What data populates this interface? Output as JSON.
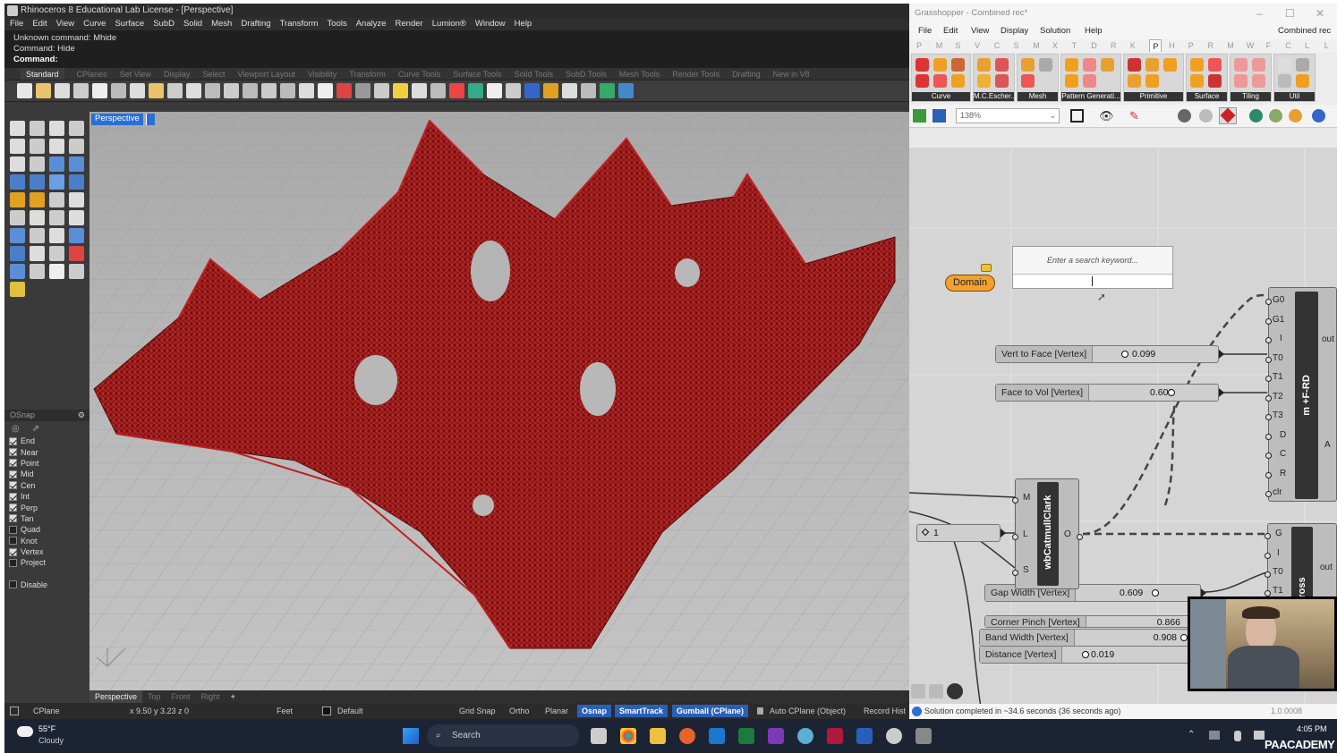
{
  "rhino": {
    "title": "Rhinoceros 8 Educational Lab License - [Perspective]",
    "menu": [
      "File",
      "Edit",
      "View",
      "Curve",
      "Surface",
      "SubD",
      "Solid",
      "Mesh",
      "Drafting",
      "Transform",
      "Tools",
      "Analyze",
      "Render",
      "Lumion®",
      "Window",
      "Help"
    ],
    "cmd_lines": [
      "Unknown command: Mhide",
      "Command: Hide"
    ],
    "cmd_prompt": "Command:",
    "toolbar_tabs": [
      "Standard",
      "CPlanes",
      "Set View",
      "Display",
      "Select",
      "Viewport Layout",
      "Visibility",
      "Transform",
      "Curve Tools",
      "Surface Tools",
      "Solid Tools",
      "SubD Tools",
      "Mesh Tools",
      "Render Tools",
      "Drafting",
      "New in V8"
    ],
    "viewport_label": "Perspective",
    "view_tabs": [
      "Perspective",
      "Top",
      "Front",
      "Right",
      "+"
    ],
    "osnap": {
      "title": "OSnap",
      "items": [
        {
          "label": "End",
          "checked": true
        },
        {
          "label": "Near",
          "checked": true
        },
        {
          "label": "Point",
          "checked": true
        },
        {
          "label": "Mid",
          "checked": true
        },
        {
          "label": "Cen",
          "checked": true
        },
        {
          "label": "Int",
          "checked": true
        },
        {
          "label": "Perp",
          "checked": true
        },
        {
          "label": "Tan",
          "checked": true
        },
        {
          "label": "Quad",
          "checked": false
        },
        {
          "label": "Knot",
          "checked": false
        },
        {
          "label": "Vertex",
          "checked": true
        },
        {
          "label": "Project",
          "checked": false
        }
      ],
      "disable": "Disable"
    },
    "status": {
      "cplane": "CPlane",
      "coords": "x 9.50 y 3.23 z 0",
      "units": "Feet",
      "layer": "Default",
      "grid_snap": "Grid Snap",
      "ortho": "Ortho",
      "planar": "Planar",
      "osnap": "Osnap",
      "smarttrack": "SmartTrack",
      "gumball": "Gumball (CPlane)",
      "auto_cplane": "Auto CPlane (Object)",
      "record": "Record Hist"
    },
    "colors": {
      "mesh": "#8e1515",
      "accent": "#2a6fd6"
    }
  },
  "gh": {
    "title": "Grasshopper - Combined rec*",
    "menu": [
      "File",
      "Edit",
      "View",
      "Display",
      "Solution",
      "Help"
    ],
    "doc_name": "Combined rec",
    "tab_letters": [
      "P",
      "M",
      "S",
      "V",
      "C",
      "S",
      "M",
      "X",
      "T",
      "D",
      "R",
      "K",
      "P",
      "H",
      "P",
      "R",
      "M",
      "W",
      "F",
      "C",
      "L",
      "L"
    ],
    "ribbon_groups": [
      "Curve",
      "M.C.Escher...",
      "Mesh",
      "Pattern Generati...",
      "Primitive",
      "Surface",
      "Tiling",
      "Util"
    ],
    "zoom": "138%",
    "search_placeholder": "Enter a search keyword...",
    "domain_label": "Domain",
    "sliders": {
      "vtf": {
        "label": "Vert to Face [Vertex]",
        "value": "0.099"
      },
      "ftv": {
        "label": "Face to Vol [Vertex]",
        "value": "0.602"
      },
      "gap": {
        "label": "Gap Width [Vertex]",
        "value": "0.609"
      },
      "corner": {
        "label": "Corner Pinch [Vertex]",
        "value": "0.866"
      },
      "band": {
        "label": "Band Width [Vertex]",
        "value": "0.908"
      },
      "dist": {
        "label": "Distance [Vertex]",
        "value": "0.019"
      },
      "int1": {
        "label": "",
        "value": "1"
      }
    },
    "frd": {
      "name": "m +F-RD",
      "inputs": [
        "G0",
        "G1",
        "I",
        "T0",
        "T1",
        "T2",
        "T3",
        "D",
        "C",
        "R",
        "clr"
      ],
      "output": "out",
      "side": "A"
    },
    "catmull": {
      "name": "wbCatmullClark",
      "inputs": [
        "M",
        "L",
        "S"
      ],
      "output": "O"
    },
    "cross": {
      "name": "Cross",
      "inputs": [
        "G",
        "I",
        "T0",
        "T1"
      ],
      "output": "out"
    },
    "status": "Solution completed in ~34.6 seconds (36 seconds ago)",
    "version": "1.0.0008"
  },
  "taskbar": {
    "temp": "55°F",
    "weather": "Cloudy",
    "search": "Search",
    "time": "4:05 PM",
    "watermark": "PAACADEMY"
  }
}
